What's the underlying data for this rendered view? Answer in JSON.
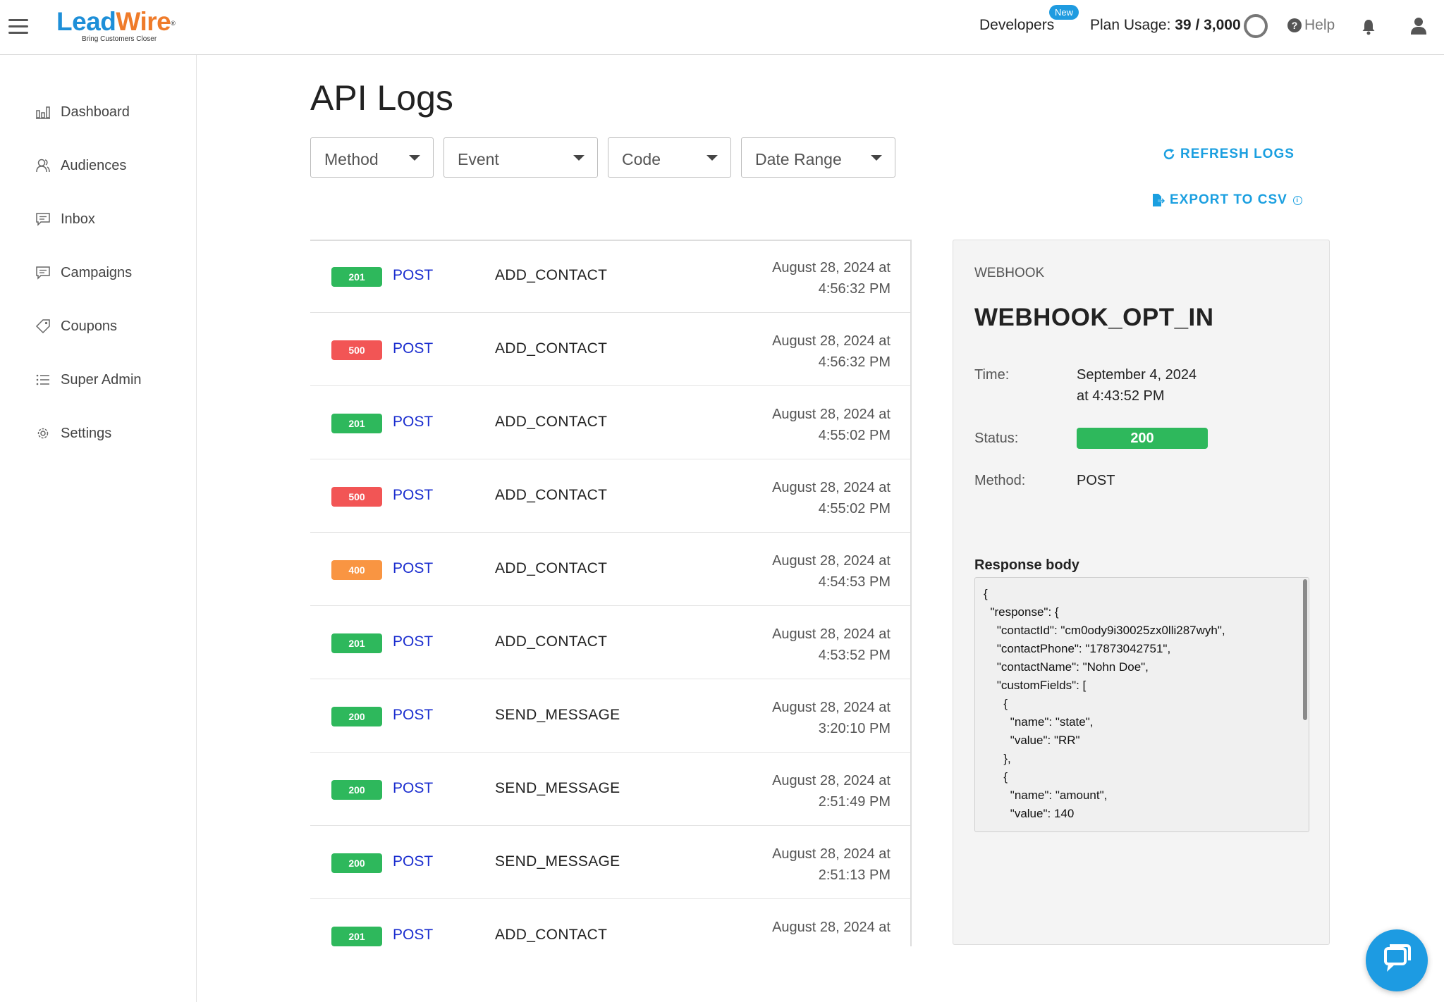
{
  "header": {
    "logo": {
      "lead": "Lead",
      "wire": "Wire",
      "reg": "®",
      "tagline": "Bring Customers Closer"
    },
    "developers_label": "Developers",
    "new_badge": "New",
    "plan_usage_label": "Plan Usage:",
    "plan_usage_value": "39 / 3,000",
    "help_label": "Help",
    "help_icon_glyph": "?"
  },
  "sidebar": {
    "items": [
      {
        "label": "Dashboard",
        "icon": "bar-chart-icon"
      },
      {
        "label": "Audiences",
        "icon": "users-icon"
      },
      {
        "label": "Inbox",
        "icon": "message-icon"
      },
      {
        "label": "Campaigns",
        "icon": "message-icon"
      },
      {
        "label": "Coupons",
        "icon": "tag-icon"
      },
      {
        "label": "Super Admin",
        "icon": "list-icon"
      },
      {
        "label": "Settings",
        "icon": "gear-icon"
      }
    ]
  },
  "main": {
    "title": "API Logs",
    "filters": {
      "method": "Method",
      "event": "Event",
      "code": "Code",
      "date_range": "Date Range"
    },
    "refresh_label": "REFRESH LOGS",
    "export_label": "EXPORT TO CSV",
    "export_info_glyph": "i"
  },
  "colors": {
    "success": "#2eb85c",
    "error": "#f25555",
    "warning": "#f99542",
    "accent": "#1a9fe0"
  },
  "logs": [
    {
      "code": "201",
      "method": "POST",
      "event": "ADD_CONTACT",
      "date": "August 28, 2024 at",
      "time": "4:56:32 PM"
    },
    {
      "code": "500",
      "method": "POST",
      "event": "ADD_CONTACT",
      "date": "August 28, 2024 at",
      "time": "4:56:32 PM"
    },
    {
      "code": "201",
      "method": "POST",
      "event": "ADD_CONTACT",
      "date": "August 28, 2024 at",
      "time": "4:55:02 PM"
    },
    {
      "code": "500",
      "method": "POST",
      "event": "ADD_CONTACT",
      "date": "August 28, 2024 at",
      "time": "4:55:02 PM"
    },
    {
      "code": "400",
      "method": "POST",
      "event": "ADD_CONTACT",
      "date": "August 28, 2024 at",
      "time": "4:54:53 PM"
    },
    {
      "code": "201",
      "method": "POST",
      "event": "ADD_CONTACT",
      "date": "August 28, 2024 at",
      "time": "4:53:52 PM"
    },
    {
      "code": "200",
      "method": "POST",
      "event": "SEND_MESSAGE",
      "date": "August 28, 2024 at",
      "time": "3:20:10 PM"
    },
    {
      "code": "200",
      "method": "POST",
      "event": "SEND_MESSAGE",
      "date": "August 28, 2024 at",
      "time": "2:51:49 PM"
    },
    {
      "code": "200",
      "method": "POST",
      "event": "SEND_MESSAGE",
      "date": "August 28, 2024 at",
      "time": "2:51:13 PM"
    },
    {
      "code": "201",
      "method": "POST",
      "event": "ADD_CONTACT",
      "date": "August 28, 2024 at",
      "time": ""
    }
  ],
  "detail": {
    "type": "WEBHOOK",
    "name": "WEBHOOK_OPT_IN",
    "time_label": "Time:",
    "time_date": "September 4, 2024",
    "time_clock": "at 4:43:52 PM",
    "status_label": "Status:",
    "status_value": "200",
    "method_label": "Method:",
    "method_value": "POST",
    "response_label": "Response body",
    "response_body": "{\n  \"response\": {\n    \"contactId\": \"cm0ody9i30025zx0lli287wyh\",\n    \"contactPhone\": \"17873042751\",\n    \"contactName\": \"Nohn Doe\",\n    \"customFields\": [\n      {\n        \"name\": \"state\",\n        \"value\": \"RR\"\n      },\n      {\n        \"name\": \"amount\",\n        \"value\": 140"
  }
}
